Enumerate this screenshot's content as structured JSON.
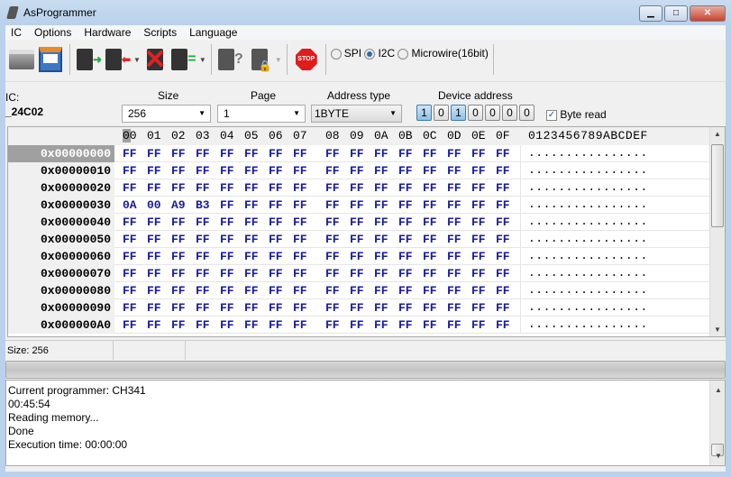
{
  "window": {
    "title": "AsProgrammer"
  },
  "menu": [
    "IC",
    "Options",
    "Hardware",
    "Scripts",
    "Language"
  ],
  "toolbar": {
    "protocols": [
      {
        "label": "SPI",
        "checked": false
      },
      {
        "label": "I2C",
        "checked": true
      },
      {
        "label": "Microwire(16bit)",
        "checked": false
      }
    ],
    "stop_label": "STOP"
  },
  "params": {
    "ic_label": "IC:",
    "ic_value": "_24C02",
    "size_label": "Size",
    "size_value": "256",
    "page_label": "Page",
    "page_value": "1",
    "addr_type_label": "Address type",
    "addr_type_value": "1BYTE",
    "device_addr_label": "Device address",
    "device_addr_bits": [
      "1",
      "0",
      "1",
      "0",
      "0",
      "0",
      "0"
    ],
    "byte_read_label": "Byte read",
    "byte_read_checked": true
  },
  "hex": {
    "columns": [
      "00",
      "01",
      "02",
      "03",
      "04",
      "05",
      "06",
      "07",
      "08",
      "09",
      "0A",
      "0B",
      "0C",
      "0D",
      "0E",
      "0F"
    ],
    "ascii_header": "0123456789ABCDEF",
    "rows": [
      {
        "addr": "0x00000000",
        "bytes": [
          "FF",
          "FF",
          "FF",
          "FF",
          "FF",
          "FF",
          "FF",
          "FF",
          "FF",
          "FF",
          "FF",
          "FF",
          "FF",
          "FF",
          "FF",
          "FF"
        ],
        "ascii": "................"
      },
      {
        "addr": "0x00000010",
        "bytes": [
          "FF",
          "FF",
          "FF",
          "FF",
          "FF",
          "FF",
          "FF",
          "FF",
          "FF",
          "FF",
          "FF",
          "FF",
          "FF",
          "FF",
          "FF",
          "FF"
        ],
        "ascii": "................"
      },
      {
        "addr": "0x00000020",
        "bytes": [
          "FF",
          "FF",
          "FF",
          "FF",
          "FF",
          "FF",
          "FF",
          "FF",
          "FF",
          "FF",
          "FF",
          "FF",
          "FF",
          "FF",
          "FF",
          "FF"
        ],
        "ascii": "................"
      },
      {
        "addr": "0x00000030",
        "bytes": [
          "0A",
          "00",
          "A9",
          "B3",
          "FF",
          "FF",
          "FF",
          "FF",
          "FF",
          "FF",
          "FF",
          "FF",
          "FF",
          "FF",
          "FF",
          "FF"
        ],
        "ascii": "................"
      },
      {
        "addr": "0x00000040",
        "bytes": [
          "FF",
          "FF",
          "FF",
          "FF",
          "FF",
          "FF",
          "FF",
          "FF",
          "FF",
          "FF",
          "FF",
          "FF",
          "FF",
          "FF",
          "FF",
          "FF"
        ],
        "ascii": "................"
      },
      {
        "addr": "0x00000050",
        "bytes": [
          "FF",
          "FF",
          "FF",
          "FF",
          "FF",
          "FF",
          "FF",
          "FF",
          "FF",
          "FF",
          "FF",
          "FF",
          "FF",
          "FF",
          "FF",
          "FF"
        ],
        "ascii": "................"
      },
      {
        "addr": "0x00000060",
        "bytes": [
          "FF",
          "FF",
          "FF",
          "FF",
          "FF",
          "FF",
          "FF",
          "FF",
          "FF",
          "FF",
          "FF",
          "FF",
          "FF",
          "FF",
          "FF",
          "FF"
        ],
        "ascii": "................"
      },
      {
        "addr": "0x00000070",
        "bytes": [
          "FF",
          "FF",
          "FF",
          "FF",
          "FF",
          "FF",
          "FF",
          "FF",
          "FF",
          "FF",
          "FF",
          "FF",
          "FF",
          "FF",
          "FF",
          "FF"
        ],
        "ascii": "................"
      },
      {
        "addr": "0x00000080",
        "bytes": [
          "FF",
          "FF",
          "FF",
          "FF",
          "FF",
          "FF",
          "FF",
          "FF",
          "FF",
          "FF",
          "FF",
          "FF",
          "FF",
          "FF",
          "FF",
          "FF"
        ],
        "ascii": "................"
      },
      {
        "addr": "0x00000090",
        "bytes": [
          "FF",
          "FF",
          "FF",
          "FF",
          "FF",
          "FF",
          "FF",
          "FF",
          "FF",
          "FF",
          "FF",
          "FF",
          "FF",
          "FF",
          "FF",
          "FF"
        ],
        "ascii": "................"
      },
      {
        "addr": "0x000000A0",
        "bytes": [
          "FF",
          "FF",
          "FF",
          "FF",
          "FF",
          "FF",
          "FF",
          "FF",
          "FF",
          "FF",
          "FF",
          "FF",
          "FF",
          "FF",
          "FF",
          "FF"
        ],
        "ascii": "................"
      }
    ]
  },
  "status": {
    "size": "Size: 256"
  },
  "progress": {
    "percent": 0
  },
  "log": [
    "Current programmer: CH341",
    "00:45:54",
    "Reading memory...",
    "Done",
    "Execution time: 00:00:00"
  ]
}
